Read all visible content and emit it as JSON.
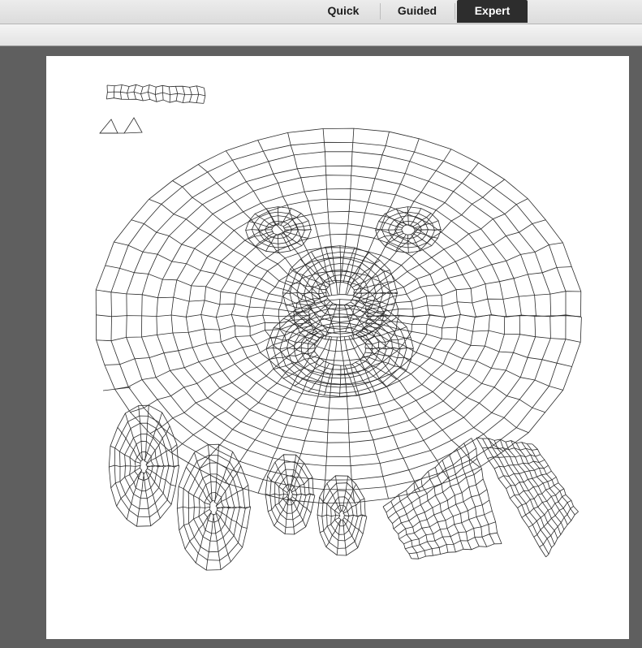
{
  "mode_tabs": {
    "quick": "Quick",
    "guided": "Guided",
    "expert": "Expert",
    "selected": "Expert"
  },
  "canvas": {
    "background_color": "#5f5f5f",
    "document_color": "#ffffff",
    "content": "UV wireframe layout"
  }
}
